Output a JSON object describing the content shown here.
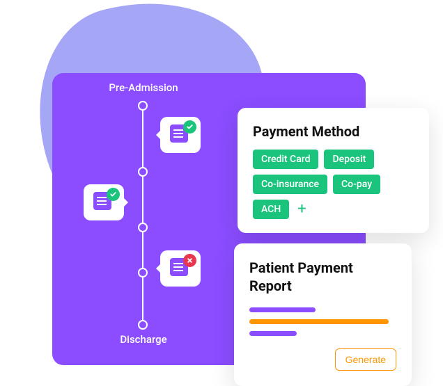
{
  "timeline": {
    "start_label": "Pre-Admission",
    "end_label": "Discharge",
    "nodes": [
      {
        "bubble": true,
        "status": "ok"
      },
      {
        "bubble": false
      },
      {
        "bubble": true,
        "status": "ok"
      },
      {
        "bubble": true,
        "status": "error"
      },
      {
        "bubble": false
      }
    ]
  },
  "payment_method": {
    "title": "Payment Method",
    "options": [
      "Credit Card",
      "Deposit",
      "Co-insurance",
      "Co-pay",
      "ACH"
    ],
    "add_icon": "+"
  },
  "report": {
    "title": "Patient Payment Report",
    "bars": [
      {
        "color": "#8B4DFF",
        "width_pct": 45
      },
      {
        "color": "#FF9500",
        "width_pct": 95
      },
      {
        "color": "#8B4DFF",
        "width_pct": 32
      }
    ],
    "action_label": "Generate"
  },
  "colors": {
    "primary_purple": "#8B4DFF",
    "blob_lavender": "#A5A6F6",
    "accent_green": "#1BC47D",
    "accent_orange": "#FF9500",
    "error_red": "#E8384F"
  }
}
